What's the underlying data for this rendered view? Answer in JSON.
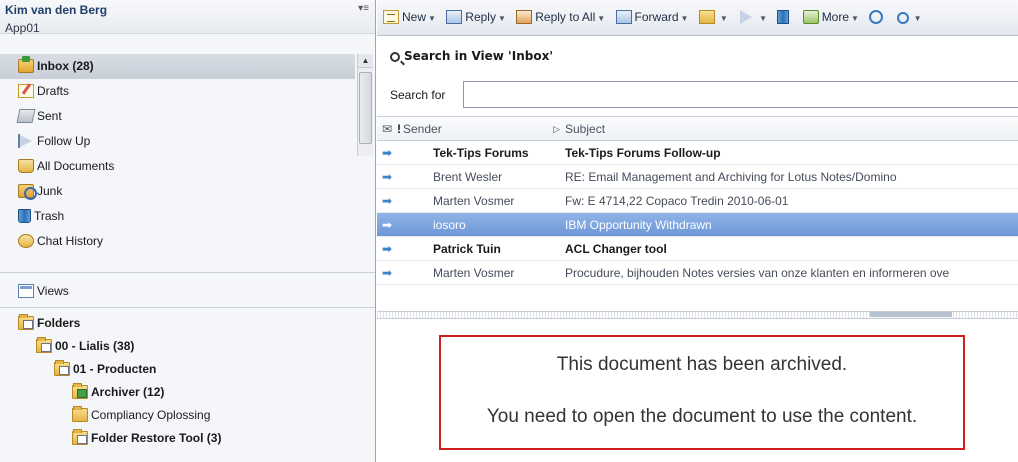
{
  "navigator": {
    "user": "Kim van den Berg",
    "app": "App01",
    "menu_glyph": "▾≡",
    "mail_items": [
      {
        "label": "Inbox (28)",
        "icon": "inbox-icon",
        "bold": true,
        "selected": true
      },
      {
        "label": "Drafts",
        "icon": "drafts-icon"
      },
      {
        "label": "Sent",
        "icon": "sent-icon"
      },
      {
        "label": "Follow Up",
        "icon": "follow-up-icon"
      },
      {
        "label": "All Documents",
        "icon": "all-documents-icon"
      },
      {
        "label": "Junk",
        "icon": "junk-icon"
      },
      {
        "label": "Trash",
        "icon": "trash-icon"
      },
      {
        "label": "Chat History",
        "icon": "chat-history-icon"
      }
    ],
    "views_label": "Views",
    "folders": [
      {
        "label": "Folders",
        "level": 0,
        "bold": true
      },
      {
        "label": "00 - Lialis (38)",
        "level": 1,
        "bold": true
      },
      {
        "label": "01 - Producten",
        "level": 2,
        "bold": true
      },
      {
        "label": "Archiver (12)",
        "level": 3,
        "bold": true,
        "variant": "green"
      },
      {
        "label": "Compliancy Oplossing",
        "level": 3,
        "bold": false,
        "variant": "plain"
      },
      {
        "label": "Folder Restore Tool (3)",
        "level": 3,
        "bold": true,
        "variant": "doc"
      }
    ]
  },
  "toolbar": {
    "new_label": "New",
    "reply_label": "Reply",
    "reply_all_label": "Reply to All",
    "forward_label": "Forward",
    "more_label": "More"
  },
  "search": {
    "title": "Search in View 'Inbox'",
    "label": "Search for",
    "value": "",
    "placeholder": ""
  },
  "list": {
    "col_sender": "Sender",
    "col_subject": "Subject",
    "rows": [
      {
        "sender": "Tek-Tips Forums",
        "subject": "Tek-Tips Forums Follow-up",
        "unread": true,
        "selected": false
      },
      {
        "sender": "Brent Wesler",
        "subject": "RE: Email Management and Archiving for Lotus Notes/Domino",
        "unread": false,
        "selected": false
      },
      {
        "sender": "Marten Vosmer",
        "subject": "Fw: E 4714,22 Copaco Tredin 2010-06-01",
        "unread": false,
        "selected": false
      },
      {
        "sender": "iosoro",
        "subject": "IBM Opportunity Withdrawn",
        "unread": false,
        "selected": true
      },
      {
        "sender": "Patrick Tuin",
        "subject": "ACL Changer tool",
        "unread": true,
        "selected": false
      },
      {
        "sender": "Marten Vosmer",
        "subject": "Procudure, bijhouden Notes versies van onze klanten en informeren ove",
        "unread": false,
        "selected": false
      }
    ]
  },
  "preview": {
    "line1": "This document has been archived.",
    "line2": "You need to open the document to use the content."
  },
  "colors": {
    "selection": "#7aa2dc",
    "archive_border": "#d01d1d"
  }
}
